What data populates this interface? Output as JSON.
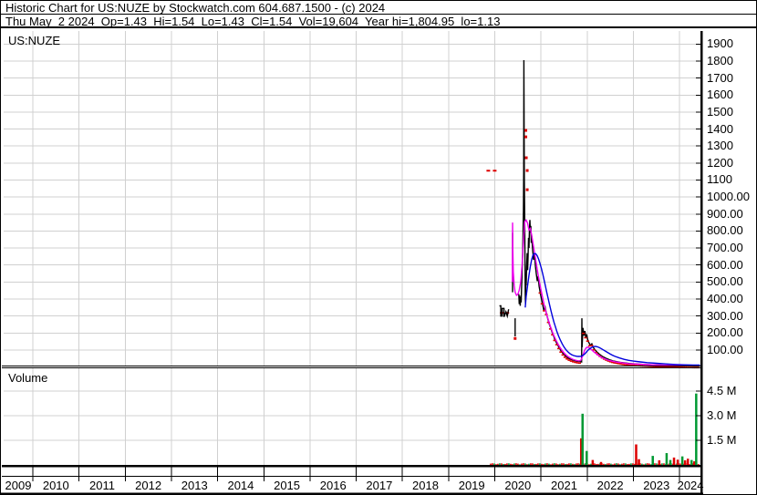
{
  "header": {
    "title": "Historic Chart for US:NUZE by Stockwatch.com 604.687.1500 - (c) 2024",
    "quote_line": "Thu May  2 2024  Op=1.43  Hi=1.54  Lo=1.43  Cl=1.54  Vol=19,604  Year hi=1,804.95  lo=1.13"
  },
  "chart": {
    "symbol": "US:NUZE",
    "volume_label": "Volume"
  },
  "chart_data": {
    "type": "line",
    "title": "Historic Chart for US:NUZE",
    "legend_position": "none",
    "grid": true,
    "x_axis": {
      "years": [
        "2009",
        "2010",
        "2011",
        "2012",
        "2013",
        "2014",
        "2015",
        "2016",
        "2017",
        "2018",
        "2019",
        "2020",
        "2021",
        "2022",
        "2023",
        "2024"
      ],
      "range": [
        2009.4,
        2024.47
      ]
    },
    "price_axis": {
      "labels": [
        "1900",
        "1800",
        "1700",
        "1600",
        "1500",
        "1400",
        "1300",
        "1200",
        "1100",
        "1000.00",
        "900.00",
        "800.00",
        "700.00",
        "600.00",
        "500.00",
        "400.00",
        "300.00",
        "200.00",
        "100.00"
      ],
      "range": [
        0,
        1970
      ],
      "year_high": 1804.95,
      "year_low": 1.13
    },
    "volume_axis": {
      "labels": [
        "4.5 M",
        "3.0 M",
        "1.5 M"
      ],
      "values": [
        4.5,
        3.0,
        1.5
      ],
      "unit": "millions of shares",
      "range": [
        0,
        5.9
      ]
    },
    "colors": {
      "price": "#000000",
      "down": "#dd0000",
      "up": "#009933",
      "ma_short": "#ee00ee",
      "ma_long": "#0000dd",
      "grid": "#d0d0d0"
    },
    "series": {
      "price_close": [
        [
          2020.52,
          430
        ],
        [
          2020.53,
          370
        ],
        [
          2020.54,
          420
        ],
        [
          2020.55,
          360
        ],
        [
          2020.56,
          410
        ],
        [
          2020.57,
          380
        ],
        [
          2020.58,
          470
        ],
        [
          2020.59,
          550
        ],
        [
          2020.6,
          640
        ],
        [
          2020.61,
          760
        ],
        [
          2020.62,
          920
        ],
        [
          2020.625,
          1150
        ],
        [
          2020.63,
          1805
        ],
        [
          2020.635,
          1350
        ],
        [
          2020.64,
          1100
        ],
        [
          2020.645,
          930
        ],
        [
          2020.65,
          780
        ],
        [
          2020.655,
          580
        ],
        [
          2020.66,
          430
        ],
        [
          2020.665,
          370
        ],
        [
          2020.67,
          450
        ],
        [
          2020.675,
          540
        ],
        [
          2020.68,
          480
        ],
        [
          2020.69,
          590
        ],
        [
          2020.7,
          670
        ],
        [
          2020.71,
          570
        ],
        [
          2020.72,
          650
        ],
        [
          2020.73,
          760
        ],
        [
          2020.74,
          700
        ],
        [
          2020.75,
          810
        ],
        [
          2020.76,
          865
        ],
        [
          2020.77,
          790
        ],
        [
          2020.78,
          830
        ],
        [
          2020.79,
          730
        ],
        [
          2020.8,
          770
        ],
        [
          2020.82,
          690
        ],
        [
          2020.84,
          630
        ],
        [
          2020.86,
          665
        ],
        [
          2020.88,
          590
        ],
        [
          2020.9,
          545
        ],
        [
          2020.92,
          505
        ],
        [
          2020.94,
          535
        ],
        [
          2020.96,
          475
        ],
        [
          2020.98,
          445
        ],
        [
          2021.0,
          415
        ],
        [
          2021.03,
          375
        ],
        [
          2021.06,
          335
        ],
        [
          2021.09,
          352
        ],
        [
          2021.12,
          312
        ],
        [
          2021.15,
          282
        ],
        [
          2021.18,
          252
        ],
        [
          2021.21,
          230
        ],
        [
          2021.24,
          206
        ],
        [
          2021.27,
          186
        ],
        [
          2021.3,
          162
        ],
        [
          2021.33,
          146
        ],
        [
          2021.36,
          131
        ],
        [
          2021.4,
          111
        ],
        [
          2021.44,
          93
        ],
        [
          2021.48,
          79
        ],
        [
          2021.52,
          67
        ],
        [
          2021.56,
          58
        ],
        [
          2021.6,
          51
        ],
        [
          2021.64,
          46
        ],
        [
          2021.68,
          42
        ],
        [
          2021.72,
          39
        ],
        [
          2021.76,
          36
        ],
        [
          2021.8,
          34
        ],
        [
          2021.84,
          32
        ],
        [
          2021.88,
          30
        ],
        [
          2021.885,
          287
        ],
        [
          2021.89,
          116
        ],
        [
          2021.91,
          230
        ],
        [
          2021.93,
          185
        ],
        [
          2021.95,
          212
        ],
        [
          2021.97,
          172
        ],
        [
          2021.99,
          192
        ],
        [
          2022.01,
          162
        ],
        [
          2022.04,
          142
        ],
        [
          2022.07,
          127
        ],
        [
          2022.1,
          136
        ],
        [
          2022.13,
          116
        ],
        [
          2022.17,
          101
        ],
        [
          2022.21,
          89
        ],
        [
          2022.26,
          76
        ],
        [
          2022.31,
          66
        ],
        [
          2022.36,
          58
        ],
        [
          2022.41,
          51
        ],
        [
          2022.46,
          45
        ],
        [
          2022.51,
          40
        ],
        [
          2022.56,
          36
        ],
        [
          2022.61,
          33
        ],
        [
          2022.71,
          28
        ],
        [
          2022.81,
          24
        ],
        [
          2022.91,
          21
        ],
        [
          2023.01,
          19
        ],
        [
          2023.11,
          17
        ],
        [
          2023.26,
          15
        ],
        [
          2023.41,
          13
        ],
        [
          2023.56,
          11
        ],
        [
          2023.71,
          10
        ],
        [
          2023.86,
          9
        ],
        [
          2024.01,
          8
        ],
        [
          2024.16,
          7
        ],
        [
          2024.31,
          6
        ],
        [
          2024.44,
          6
        ]
      ],
      "price_early_segments": [
        [
          [
            2020.1,
            360
          ],
          [
            2020.13,
            360
          ],
          [
            2020.13,
            300
          ],
          [
            2020.16,
            300
          ],
          [
            2020.16,
            345
          ],
          [
            2020.2,
            345
          ],
          [
            2020.2,
            295
          ],
          [
            2020.24,
            325
          ],
          [
            2020.27,
            300
          ],
          [
            2020.3,
            340
          ]
        ],
        [
          [
            2020.385,
            790
          ],
          [
            2020.385,
            440
          ]
        ],
        [
          [
            2020.44,
            287
          ],
          [
            2020.44,
            180
          ]
        ]
      ],
      "pre_spike_dashed": [
        [
          [
            2019.82,
            1155
          ],
          [
            2020.09,
            1155
          ]
        ],
        [
          [
            2020.11,
            318
          ],
          [
            2020.31,
            318
          ]
        ]
      ],
      "down_day_dots": [
        [
          2020.44,
          168
        ],
        [
          2020.672,
          1392
        ],
        [
          2020.672,
          1354
        ],
        [
          2020.682,
          1231
        ],
        [
          2020.702,
          1156
        ],
        [
          2020.702,
          1043
        ]
      ],
      "ma_short": [
        [
          2020.38,
          500
        ],
        [
          2020.385,
          850
        ],
        [
          2020.39,
          690
        ],
        [
          2020.4,
          560
        ],
        [
          2020.42,
          480
        ],
        [
          2020.44,
          440
        ],
        [
          2020.47,
          422
        ],
        [
          2020.5,
          428
        ],
        [
          2020.53,
          452
        ],
        [
          2020.56,
          500
        ],
        [
          2020.59,
          600
        ],
        [
          2020.62,
          740
        ],
        [
          2020.65,
          855
        ],
        [
          2020.68,
          865
        ],
        [
          2020.71,
          845
        ],
        [
          2020.74,
          805
        ],
        [
          2020.77,
          815
        ],
        [
          2020.8,
          775
        ],
        [
          2020.83,
          725
        ],
        [
          2020.86,
          672
        ],
        [
          2020.89,
          622
        ],
        [
          2020.92,
          572
        ],
        [
          2020.95,
          526
        ],
        [
          2020.98,
          482
        ],
        [
          2021.01,
          441
        ],
        [
          2021.04,
          402
        ],
        [
          2021.07,
          366
        ],
        [
          2021.1,
          333
        ],
        [
          2021.13,
          303
        ],
        [
          2021.16,
          276
        ],
        [
          2021.19,
          250
        ],
        [
          2021.22,
          227
        ],
        [
          2021.25,
          205
        ],
        [
          2021.28,
          185
        ],
        [
          2021.31,
          167
        ],
        [
          2021.34,
          150
        ],
        [
          2021.38,
          130
        ],
        [
          2021.42,
          112
        ],
        [
          2021.46,
          96
        ],
        [
          2021.5,
          83
        ],
        [
          2021.54,
          72
        ],
        [
          2021.58,
          63
        ],
        [
          2021.62,
          55
        ],
        [
          2021.66,
          49
        ],
        [
          2021.7,
          44
        ],
        [
          2021.74,
          41
        ],
        [
          2021.78,
          38
        ],
        [
          2021.82,
          36
        ],
        [
          2021.86,
          38
        ],
        [
          2021.9,
          62
        ],
        [
          2021.94,
          96
        ],
        [
          2021.98,
          114
        ],
        [
          2022.02,
          117
        ],
        [
          2022.06,
          110
        ],
        [
          2022.1,
          100
        ],
        [
          2022.15,
          88
        ],
        [
          2022.2,
          77
        ],
        [
          2022.25,
          67
        ],
        [
          2022.3,
          59
        ],
        [
          2022.35,
          52
        ],
        [
          2022.4,
          46
        ],
        [
          2022.45,
          41
        ],
        [
          2022.5,
          37
        ],
        [
          2022.6,
          31
        ],
        [
          2022.7,
          27
        ],
        [
          2022.8,
          23
        ],
        [
          2022.9,
          20
        ],
        [
          2023.0,
          18
        ],
        [
          2023.15,
          16
        ],
        [
          2023.3,
          14
        ],
        [
          2023.5,
          12
        ],
        [
          2023.7,
          10
        ],
        [
          2023.9,
          9
        ],
        [
          2024.1,
          8
        ],
        [
          2024.3,
          7
        ],
        [
          2024.44,
          7
        ]
      ],
      "ma_long": [
        [
          2020.66,
          350
        ],
        [
          2020.68,
          415
        ],
        [
          2020.71,
          480
        ],
        [
          2020.74,
          540
        ],
        [
          2020.77,
          592
        ],
        [
          2020.8,
          634
        ],
        [
          2020.83,
          660
        ],
        [
          2020.86,
          668
        ],
        [
          2020.89,
          665
        ],
        [
          2020.92,
          654
        ],
        [
          2020.95,
          634
        ],
        [
          2020.98,
          608
        ],
        [
          2021.01,
          578
        ],
        [
          2021.04,
          545
        ],
        [
          2021.07,
          509
        ],
        [
          2021.1,
          472
        ],
        [
          2021.13,
          434
        ],
        [
          2021.16,
          397
        ],
        [
          2021.19,
          361
        ],
        [
          2021.22,
          327
        ],
        [
          2021.25,
          295
        ],
        [
          2021.28,
          265
        ],
        [
          2021.31,
          238
        ],
        [
          2021.34,
          212
        ],
        [
          2021.38,
          183
        ],
        [
          2021.42,
          158
        ],
        [
          2021.46,
          136
        ],
        [
          2021.5,
          117
        ],
        [
          2021.54,
          102
        ],
        [
          2021.58,
          90
        ],
        [
          2021.62,
          80
        ],
        [
          2021.66,
          73
        ],
        [
          2021.7,
          68
        ],
        [
          2021.74,
          65
        ],
        [
          2021.78,
          63
        ],
        [
          2021.82,
          62
        ],
        [
          2021.86,
          63
        ],
        [
          2021.9,
          67
        ],
        [
          2021.94,
          75
        ],
        [
          2021.98,
          87
        ],
        [
          2022.02,
          99
        ],
        [
          2022.06,
          109
        ],
        [
          2022.1,
          116
        ],
        [
          2022.14,
          120
        ],
        [
          2022.18,
          121
        ],
        [
          2022.22,
          119
        ],
        [
          2022.26,
          115
        ],
        [
          2022.3,
          109
        ],
        [
          2022.35,
          101
        ],
        [
          2022.4,
          92
        ],
        [
          2022.45,
          84
        ],
        [
          2022.5,
          76
        ],
        [
          2022.55,
          69
        ],
        [
          2022.6,
          63
        ],
        [
          2022.7,
          53
        ],
        [
          2022.8,
          45
        ],
        [
          2022.9,
          39
        ],
        [
          2023.0,
          35
        ],
        [
          2023.15,
          30
        ],
        [
          2023.3,
          26
        ],
        [
          2023.5,
          22
        ],
        [
          2023.7,
          18
        ],
        [
          2023.9,
          15
        ],
        [
          2024.1,
          13
        ],
        [
          2024.3,
          11
        ],
        [
          2024.44,
          11
        ]
      ]
    },
    "red_tick_regions": [
      [
        2020.98,
        2021.86
      ],
      [
        2021.92,
        2024.44
      ]
    ],
    "volume_bars": [
      [
        2021.87,
        1.62,
        "down"
      ],
      [
        2021.9,
        3.12,
        "up"
      ],
      [
        2021.99,
        0.85,
        "up"
      ],
      [
        2022.12,
        0.3,
        "down"
      ],
      [
        2022.3,
        0.18,
        "down"
      ],
      [
        2023.06,
        1.25,
        "down"
      ],
      [
        2023.12,
        0.35,
        "down"
      ],
      [
        2023.42,
        0.55,
        "up"
      ],
      [
        2023.56,
        0.28,
        "down"
      ],
      [
        2023.72,
        0.72,
        "up"
      ],
      [
        2023.8,
        0.3,
        "up"
      ],
      [
        2023.88,
        0.45,
        "down"
      ],
      [
        2023.96,
        0.32,
        "down"
      ],
      [
        2024.06,
        0.52,
        "up"
      ],
      [
        2024.12,
        0.28,
        "down"
      ],
      [
        2024.18,
        0.38,
        "down"
      ],
      [
        2024.26,
        0.3,
        "up"
      ],
      [
        2024.32,
        0.22,
        "down"
      ],
      [
        2024.36,
        4.35,
        "up"
      ]
    ],
    "volume_baseline": {
      "from": 2019.91,
      "to": 2024.44,
      "max": 0.1
    }
  }
}
